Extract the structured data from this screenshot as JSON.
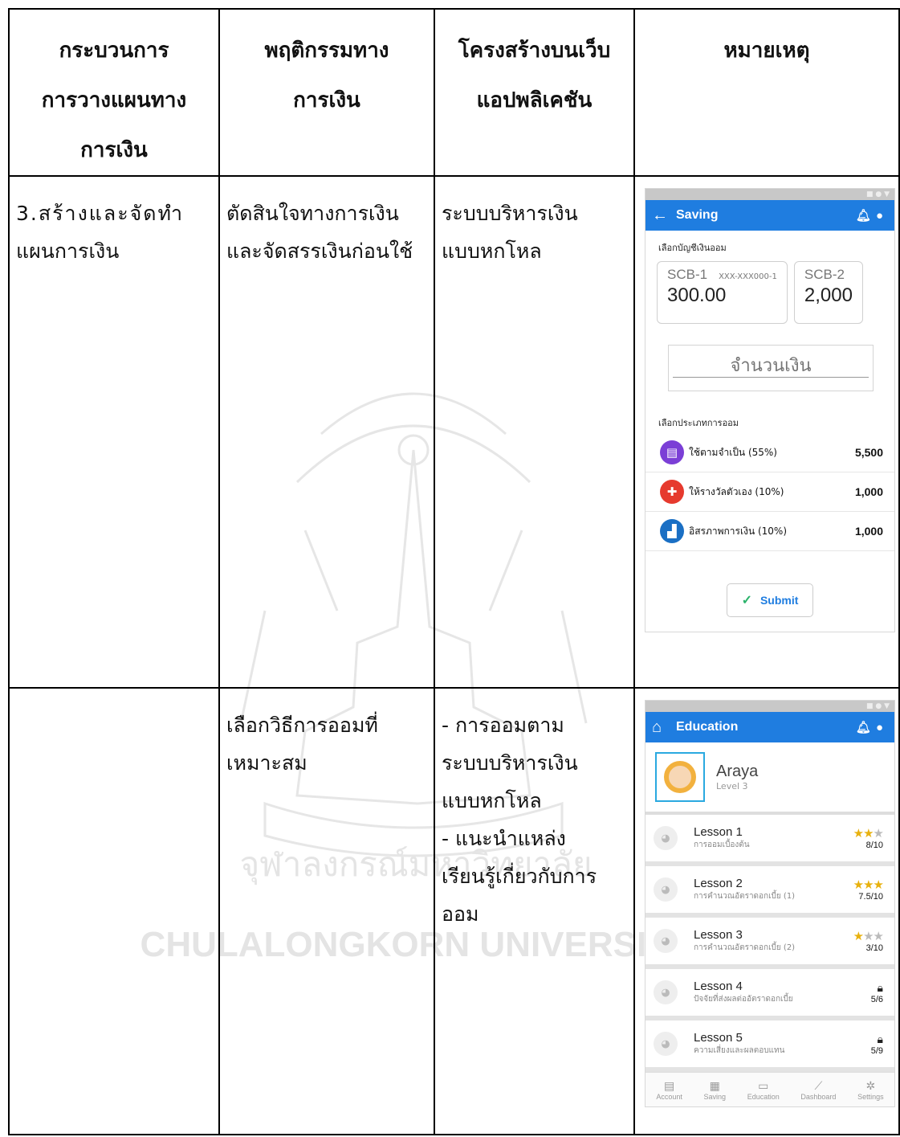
{
  "headers": [
    [
      "กระบวนการ",
      "การวางแผนทาง",
      "การเงิน"
    ],
    [
      "พฤติกรรมทาง",
      "การเงิน"
    ],
    [
      "โครงสร้างบนเว็บ",
      "แอปพลิเคชัน"
    ],
    [
      "หมายเหตุ"
    ]
  ],
  "rows": [
    {
      "process": [
        "3.สร้างและจัดทำ",
        "แผนการเงิน"
      ],
      "behavior": [
        "ตัดสินใจทางการเงิน",
        "และจัดสรรเงินก่อนใช้"
      ],
      "structure": [
        "ระบบบริหารเงิน",
        "แบบหกโหล"
      ]
    },
    {
      "process": [],
      "behavior": [
        "เลือกวิธีการออมที่",
        "เหมาะสม"
      ],
      "structure": [
        "- การออมตาม",
        "ระบบบริหารเงิน",
        "แบบหกโหล",
        "- แนะนำแหล่ง",
        "เรียนรู้เกี่ยวกับการ",
        "ออม"
      ]
    }
  ],
  "watermark": {
    "thai": "จุฬาลงกรณ์มหาวิทยาลัย",
    "english": "CHULALONGKORN UNIVERSITY"
  },
  "saving_screen": {
    "title": "Saving",
    "account_label": "เลือกบัญชีเงินออม",
    "accounts": [
      {
        "name": "SCB-1",
        "number": "XXX-XXX000-1",
        "amount": "300.00"
      },
      {
        "name": "SCB-2",
        "number": "",
        "amount": "2,000"
      }
    ],
    "amount_placeholder": "จำนวนเงิน",
    "category_label": "เลือกประเภทการออม",
    "categories": [
      {
        "name": "ใช้ตามจำเป็น (55%)",
        "value": "5,500",
        "color": "#7b3fd6",
        "icon": "wallet-icon"
      },
      {
        "name": "ให้รางวัลตัวเอง (10%)",
        "value": "1,000",
        "color": "#e63a2e",
        "icon": "gift-icon"
      },
      {
        "name": "อิสรภาพการเงิน (10%)",
        "value": "1,000",
        "color": "#1a6fc4",
        "icon": "growth-icon"
      }
    ],
    "submit_label": "Submit"
  },
  "education_screen": {
    "title": "Education",
    "user_name": "Araya",
    "user_level": "Level 3",
    "lessons": [
      {
        "name": "Lesson 1",
        "subtitle": "การออมเบื้องต้น",
        "score": "8/10",
        "stars": 2,
        "locked": false
      },
      {
        "name": "Lesson 2",
        "subtitle": "การคำนวณอัตราดอกเบี้ย (1)",
        "score": "7.5/10",
        "stars": 3,
        "locked": false
      },
      {
        "name": "Lesson 3",
        "subtitle": "การคำนวณอัตราดอกเบี้ย (2)",
        "score": "3/10",
        "stars": 1,
        "locked": false
      },
      {
        "name": "Lesson 4",
        "subtitle": "ปัจจัยที่ส่งผลต่ออัตราดอกเบี้ย",
        "score": "5/6",
        "stars": 0,
        "locked": true
      },
      {
        "name": "Lesson 5",
        "subtitle": "ความเสี่ยงและผลตอบแทน",
        "score": "5/9",
        "stars": 0,
        "locked": true
      }
    ],
    "nav": [
      "Account",
      "Saving",
      "Education",
      "Dashboard",
      "Settings"
    ]
  },
  "colors": {
    "app_blue": "#1f7de0",
    "star_gold": "#e8b10e"
  }
}
